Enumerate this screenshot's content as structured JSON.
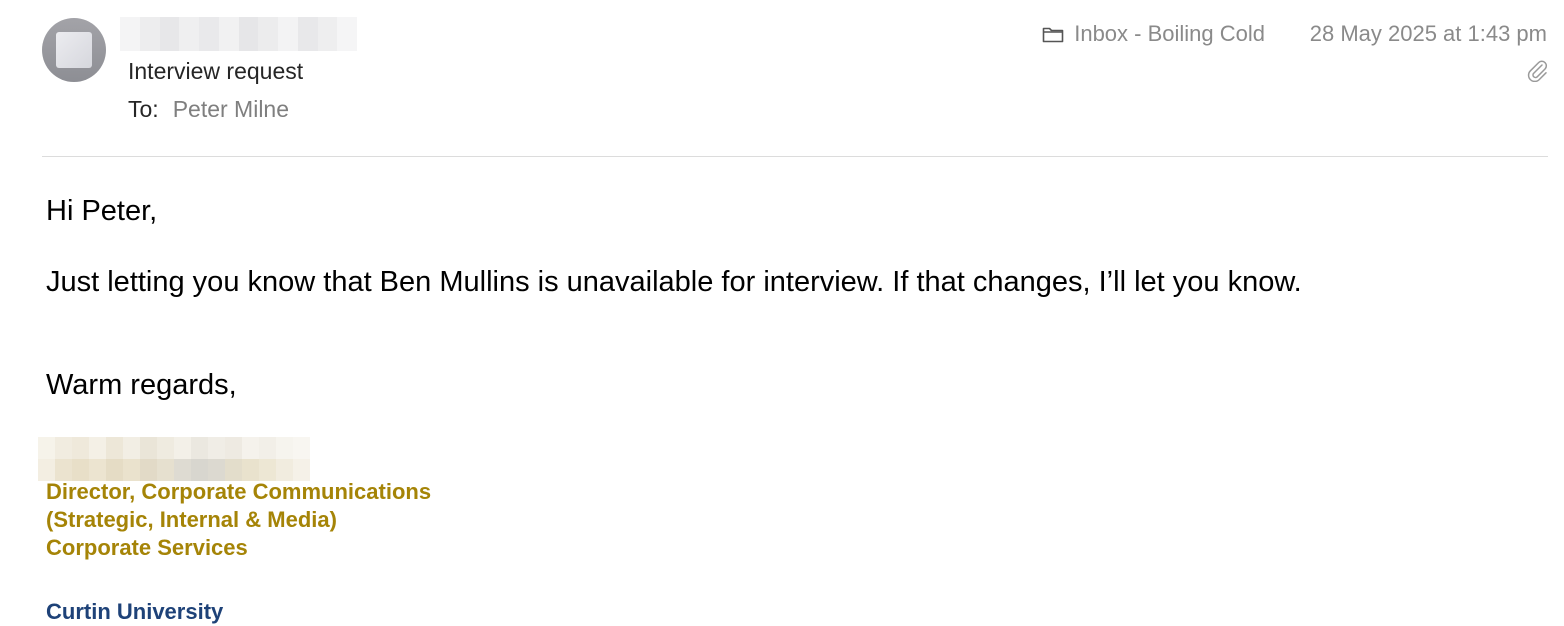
{
  "header": {
    "subject": "Interview request",
    "to_label": "To:",
    "to_value": "Peter Milne",
    "mailbox": "Inbox - Boiling Cold",
    "date": "28 May 2025 at 1:43 pm",
    "mailbox_icon": "folder-icon",
    "attachment_icon": "paperclip-icon"
  },
  "body": {
    "greeting": "Hi Peter,",
    "message": "Just letting you know that Ben Mullins is unavailable for interview. If that changes, I’ll let you know.",
    "signoff": "Warm regards,"
  },
  "signature": {
    "line1": "Director, Corporate Communications",
    "line2": "(Strategic, Internal & Media)",
    "line3": "Corporate Services",
    "org": "Curtin University"
  },
  "colors": {
    "signature_gold": "#a58407",
    "signature_navy": "#1e4278",
    "muted_text": "#8a8a8a"
  }
}
